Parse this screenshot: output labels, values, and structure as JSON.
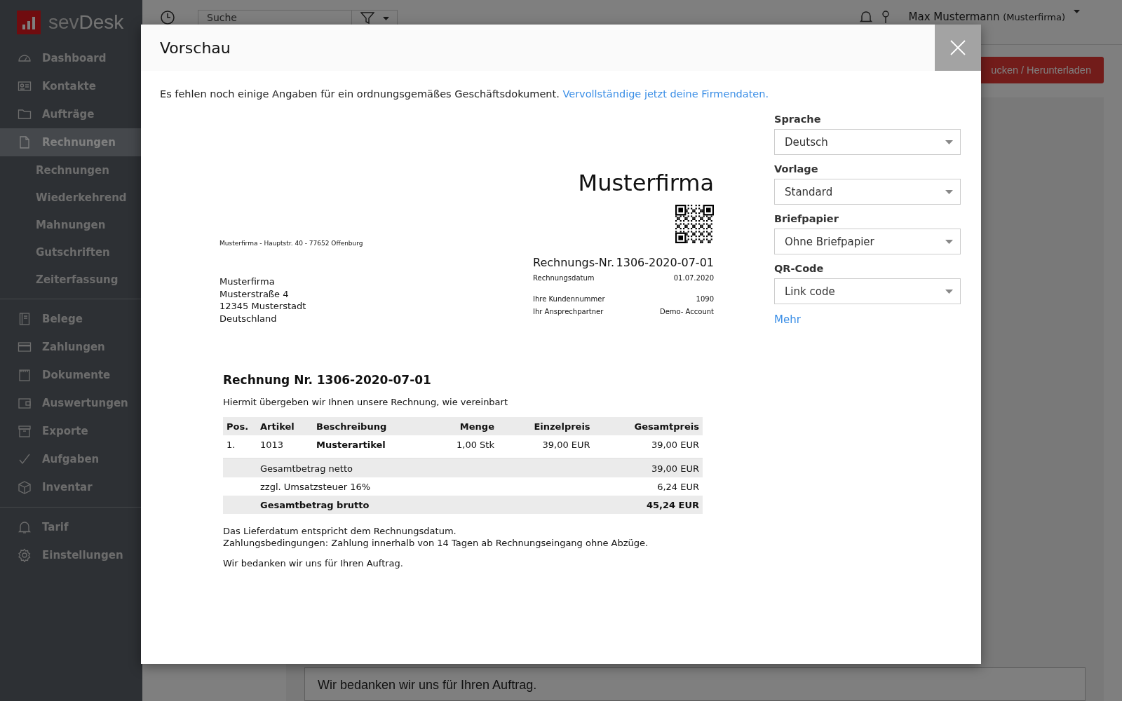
{
  "sidebar": {
    "logo": {
      "light": "sev",
      "strong": "Desk"
    },
    "groups": [
      [
        {
          "label": "Dashboard",
          "kind": "gauge",
          "selected": false
        },
        {
          "label": "Kontakte",
          "kind": "card",
          "selected": false
        },
        {
          "label": "Aufträge",
          "kind": "folder",
          "selected": false
        },
        {
          "label": "Rechnungen",
          "kind": "doc",
          "selected": true,
          "children": [
            {
              "label": "Rechnungen",
              "selected": false
            },
            {
              "label": "Wiederkehrend",
              "selected": false
            },
            {
              "label": "Mahnungen",
              "selected": false
            },
            {
              "label": "Gutschriften",
              "selected": false
            },
            {
              "label": "Zeiterfassung",
              "selected": false
            }
          ]
        }
      ],
      [
        {
          "label": "Belege",
          "kind": "book",
          "selected": false
        },
        {
          "label": "Zahlungen",
          "kind": "creditcard",
          "selected": false
        },
        {
          "label": "Dokumente",
          "kind": "notepad",
          "selected": false
        },
        {
          "label": "Auswertungen",
          "kind": "wallet",
          "selected": false
        },
        {
          "label": "Exporte",
          "kind": "archive",
          "selected": false
        },
        {
          "label": "Aufgaben",
          "kind": "check",
          "selected": false
        },
        {
          "label": "Inventar",
          "kind": "box",
          "selected": false
        }
      ],
      [
        {
          "label": "Tarif",
          "kind": "bell",
          "selected": false
        },
        {
          "label": "Einstellungen",
          "kind": "gear",
          "selected": false
        }
      ]
    ]
  },
  "topbar": {
    "search": {
      "placeholder": "Suche"
    },
    "user": {
      "name": "Max Mustermann",
      "company": "(Musterfirma)"
    },
    "action_button": "ucken / Herunterladen"
  },
  "background": {
    "closing_text": "Wir bedanken wir uns für Ihren Auftrag."
  },
  "modal": {
    "title": "Vorschau",
    "notice": {
      "text": "Es fehlen noch einige Angaben für ein ordnungsgemäßes Geschäftsdokument.",
      "link": "Vervollständige jetzt deine Firmendaten."
    },
    "document": {
      "company": "Musterfirma",
      "sender_line": "Musterfirma - Hauptstr. 40 - 77652 Offenburg",
      "recipient": [
        "Musterfirma",
        "Musterstraße 4",
        "12345 Musterstadt",
        "Deutschland"
      ],
      "number_label": "Rechnungs-Nr.",
      "number": "1306-2020-07-01",
      "meta": [
        [
          {
            "label": "Rechnungsdatum",
            "value": "01.07.2020"
          }
        ],
        [
          {
            "label": "Ihre Kundennummer",
            "value": "1090"
          },
          {
            "label": "Ihr Ansprechpartner",
            "value": "Demo- Account"
          }
        ]
      ],
      "title": "Rechnung Nr. 1306-2020-07-01",
      "intro": "Hiermit übergeben wir Ihnen unsere Rechnung, wie vereinbart",
      "columns": [
        "Pos.",
        "Artikel",
        "Beschreibung",
        "Menge",
        "Einzelpreis",
        "Gesamtpreis"
      ],
      "rows": [
        [
          "1.",
          "1013",
          "Musterartikel",
          "1,00 Stk",
          "39,00 EUR",
          "39,00 EUR"
        ]
      ],
      "totals": [
        {
          "label": "Gesamtbetrag netto",
          "value": "39,00 EUR",
          "shaded": true,
          "bold": false
        },
        {
          "label": "zzgl. Umsatzsteuer 16%",
          "value": "6,24 EUR",
          "shaded": false,
          "bold": false
        },
        {
          "label": "Gesamtbetrag brutto",
          "value": "45,24 EUR",
          "shaded": true,
          "bold": true
        }
      ],
      "notes": [
        "Das Lieferdatum entspricht dem Rechnungsdatum.",
        "Zahlungsbedingungen: Zahlung innerhalb von 14 Tagen ab Rechnungseingang ohne Abzüge."
      ],
      "closing": "Wir bedanken wir uns für Ihren Auftrag."
    },
    "settings": [
      {
        "label": "Sprache",
        "value": "Deutsch"
      },
      {
        "label": "Vorlage",
        "value": "Standard"
      },
      {
        "label": "Briefpapier",
        "value": "Ohne Briefpapier"
      },
      {
        "label": "QR-Code",
        "value": "Link code"
      }
    ],
    "more_link": "Mehr"
  }
}
